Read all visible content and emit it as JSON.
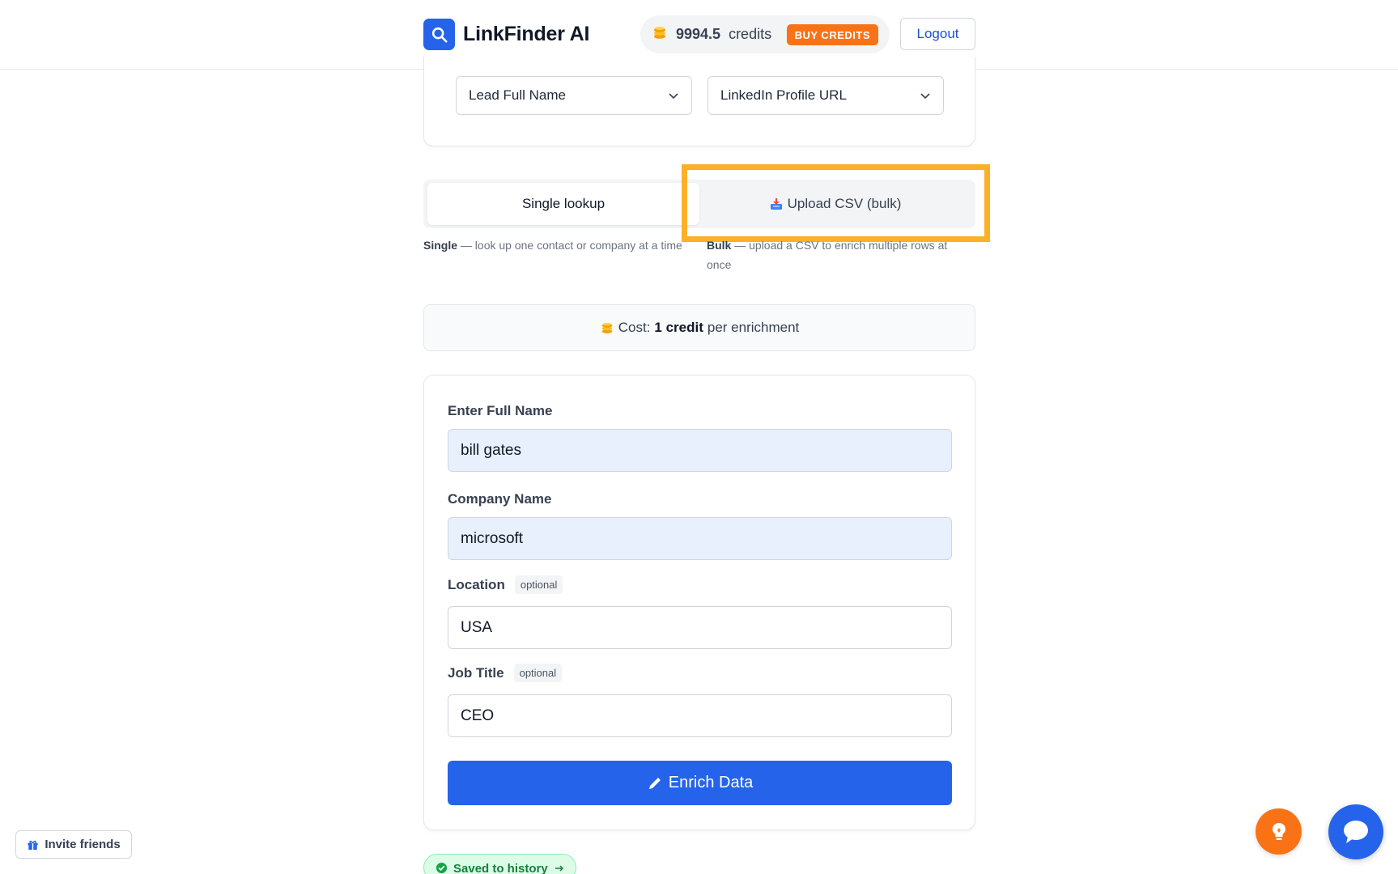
{
  "header": {
    "brand": "LinkFinder AI",
    "logo_icon": "search-icon",
    "credits_value": "9994.5",
    "credits_label": "credits",
    "buy_credits": "BUY CREDITS",
    "logout": "Logout"
  },
  "mapping": {
    "select_name": "Lead Full Name",
    "select_url": "LinkedIn Profile URL"
  },
  "tabs": {
    "single": "Single lookup",
    "bulk": "Upload CSV (bulk)",
    "active": "single"
  },
  "descriptions": {
    "single_bold": "Single",
    "single_text": " — look up one contact or company at a time",
    "bulk_bold": "Bulk",
    "bulk_text": " — upload a CSV to enrich multiple rows at once"
  },
  "cost": {
    "prefix": "Cost:",
    "amount": "1 credit",
    "suffix": "per enrichment"
  },
  "form": {
    "full_name_label": "Enter Full Name",
    "full_name_value": "bill gates",
    "company_label": "Company Name",
    "company_value": "microsoft",
    "location_label": "Location",
    "location_value": "USA",
    "job_title_label": "Job Title",
    "job_title_value": "CEO",
    "optional_tag": "optional",
    "submit": "Enrich Data"
  },
  "status": {
    "saved": "Saved to history"
  },
  "invite": {
    "label": "Invite friends"
  },
  "colors": {
    "primary": "#2563eb",
    "accent": "#f97316",
    "highlight": "#fbb02a",
    "success": "#15803d"
  }
}
